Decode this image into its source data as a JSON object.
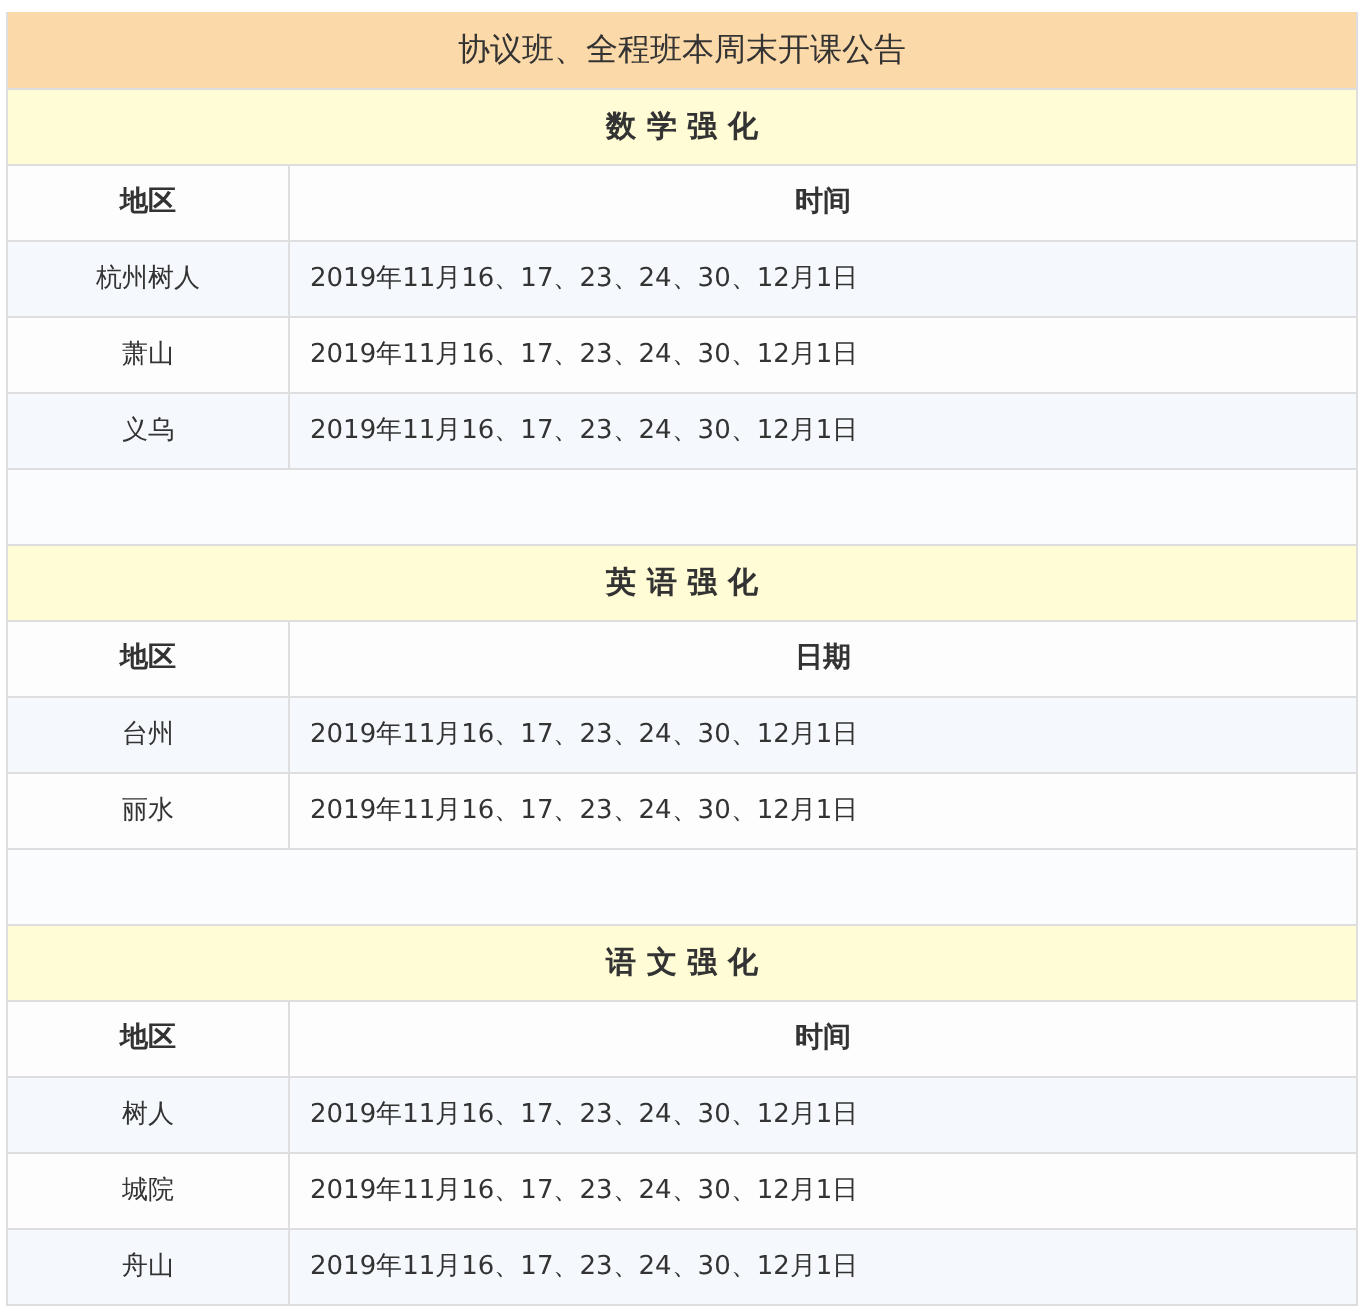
{
  "title": "协议班、全程班本周末开课公告",
  "sections": [
    {
      "heading": "数 学 强 化",
      "columns": [
        "地区",
        "时间"
      ],
      "rows": [
        {
          "region": "杭州树人",
          "dates": "2019年11月16、17、23、24、30、12月1日"
        },
        {
          "region": "萧山",
          "dates": "2019年11月16、17、23、24、30、12月1日"
        },
        {
          "region": "义乌",
          "dates": "2019年11月16、17、23、24、30、12月1日"
        }
      ]
    },
    {
      "heading": "英 语 强 化",
      "columns": [
        "地区",
        "日期"
      ],
      "rows": [
        {
          "region": "台州",
          "dates": "2019年11月16、17、23、24、30、12月1日"
        },
        {
          "region": "丽水",
          "dates": "2019年11月16、17、23、24、30、12月1日"
        }
      ]
    },
    {
      "heading": "语 文 强 化",
      "columns": [
        "地区",
        "时间"
      ],
      "rows": [
        {
          "region": "树人",
          "dates": "2019年11月16、17、23、24、30、12月1日"
        },
        {
          "region": "城院",
          "dates": "2019年11月16、17、23、24、30、12月1日"
        },
        {
          "region": "舟山",
          "dates": "2019年11月16、17、23、24、30、12月1日"
        }
      ]
    }
  ]
}
